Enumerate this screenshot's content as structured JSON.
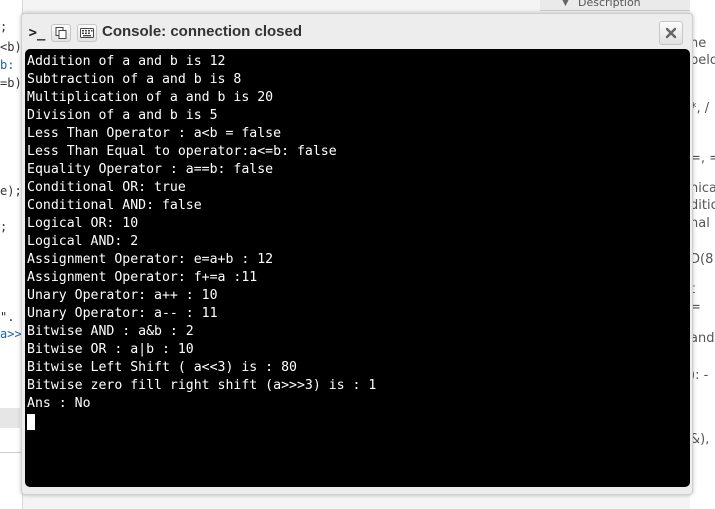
{
  "window": {
    "title": "Console: connection closed",
    "prompt_symbol": ">_"
  },
  "output_lines": [
    "Addition of a and b is 12",
    "Subtraction of a and b is 8",
    "Multiplication of a and b is 20",
    "Division of a and b is 5",
    "Less Than Operator : a<b = false",
    "Less Than Equal to operator:a<=b: false",
    "Equality Operator : a==b: false",
    "Conditional OR: true",
    "Conditional AND: false",
    "Logical OR: 10",
    "Logical AND: 2",
    "Assignment Operator: e=a+b : 12",
    "Assignment Operator: f+=a :11",
    "Unary Operator: a++ : 10",
    "Unary Operator: a-- : 11",
    "Bitwise AND : a&b : 2",
    "Bitwise OR : a|b : 10",
    "Bitwise Left Shift ( a<<3) is : 80",
    "Bitwise zero fill right shift (a>>>3) is : 1",
    "Ans : No"
  ],
  "background": {
    "top_panel_label": "Description",
    "left_fragments": [
      ";",
      "<b)",
      "b:",
      "=b)",
      "e);",
      ";",
      "\".",
      "a>>"
    ],
    "right_fragments": [
      "ne",
      "belo",
      "*, /",
      "=, =",
      "nica",
      "ditio",
      "nal",
      "D(8",
      "t",
      "=",
      "and",
      "): -",
      "&),"
    ]
  },
  "colors": {
    "terminal_bg": "#000000",
    "terminal_fg": "#ffffff",
    "window_bg": "#ededed"
  }
}
